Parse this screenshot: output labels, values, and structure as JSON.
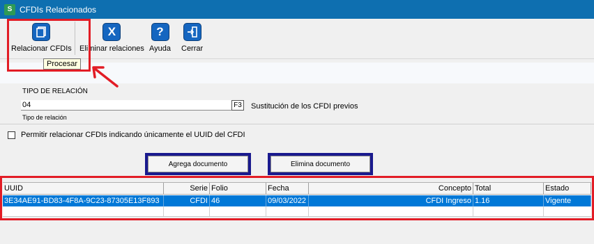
{
  "window": {
    "title": "CFDIs Relacionados",
    "app_icon": "S"
  },
  "toolbar": {
    "buttons": [
      {
        "label": "Relacionar CFDIs",
        "icon": "stack-icon"
      },
      {
        "label": "Eliminar relaciones",
        "icon": "x-icon"
      },
      {
        "label": "Ayuda",
        "icon": "help-icon"
      },
      {
        "label": "Cerrar",
        "icon": "exit-icon"
      }
    ],
    "tooltip": "Procesar"
  },
  "relation": {
    "heading": "TIPO DE RELACIÓN",
    "code": "04",
    "lookup_key": "F3",
    "description": "Sustitución de los CFDI previos",
    "sublabel": "Tipo de relación"
  },
  "uuid_option": {
    "label": "Permitir relacionar CFDIs indicando únicamente el UUID del CFDI",
    "checked": false
  },
  "actions": {
    "add": "Agrega documento",
    "remove": "Elimina documento"
  },
  "table": {
    "columns": [
      "UUID",
      "Serie",
      "Folio",
      "Fecha",
      "Concepto",
      "Total",
      "Estado"
    ],
    "rows": [
      [
        "3E34AE91-BD83-4F8A-9C23-87305E13F893",
        "CFDI",
        "46",
        "09/03/2022",
        "CFDI Ingreso",
        "1.16",
        "Vigente"
      ]
    ]
  },
  "colors": {
    "titlebar": "#0e6fb0",
    "selected_row": "#0078d7",
    "annotation": "#e21c25",
    "action_frame": "#1a1a8e"
  }
}
